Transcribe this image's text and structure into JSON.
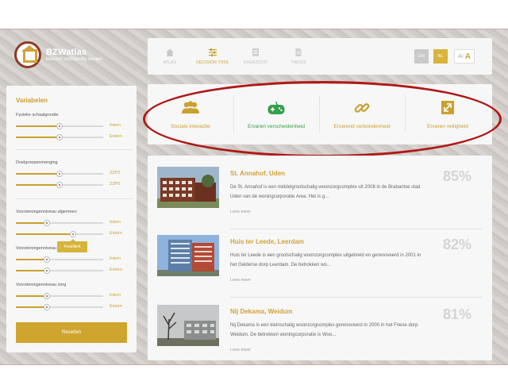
{
  "logo": {
    "title": "BZWatlas",
    "subtitle": "beschut zelfstandig wonen"
  },
  "nav": {
    "items": [
      {
        "label": "ATLAS",
        "icon": "home-icon"
      },
      {
        "label": "DECISION TOOL",
        "icon": "sliders-icon"
      },
      {
        "label": "OVERZICHT",
        "icon": "document-icon"
      },
      {
        "label": "THESIS",
        "icon": "file-icon"
      }
    ],
    "active": "DECISION TOOL"
  },
  "language": {
    "en": "EN",
    "nl": "NL",
    "font_small": "A",
    "font_sep": "/",
    "font_large": "A"
  },
  "sidebar": {
    "title": "Variabelen",
    "groups": [
      {
        "title": "Fysieke schaalgrootte",
        "sliders": [
          {
            "label": "Intern",
            "value": 0.5
          },
          {
            "label": "Extern",
            "value": 0.5
          }
        ]
      },
      {
        "title": "Doelgroepenmenging",
        "sliders": [
          {
            "label": "ZZP2",
            "value": 0.5
          },
          {
            "label": "ZZP5",
            "value": 0.5
          }
        ]
      },
      {
        "title": "Voorzieningenniveau algemeen",
        "sliders": [
          {
            "label": "Intern",
            "value": 0.35
          },
          {
            "label": "Extern",
            "value": 0.65
          }
        ]
      },
      {
        "title": "Voorzieningenniveau",
        "sliders": [
          {
            "label": "Intern",
            "value": 0.35
          },
          {
            "label": "Extern",
            "value": 0.35
          }
        ]
      },
      {
        "title": "Voorzieningenniveau zorg",
        "sliders": [
          {
            "label": "Intern",
            "value": 0.35
          },
          {
            "label": "Extern",
            "value": 0.35
          }
        ]
      }
    ],
    "tooltip": "Kwaliteit",
    "reset_label": "Resetten"
  },
  "filters": [
    {
      "label": "Sociale interactie",
      "icon": "people-icon",
      "color": "#c9a12f"
    },
    {
      "label": "Ervaren verscheidenheid",
      "icon": "gamepad-icon",
      "color": "#35a04a"
    },
    {
      "label": "Ervarend verbondenheid",
      "icon": "link-icon",
      "color": "#c9a12f"
    },
    {
      "label": "Ervaren veiligheid",
      "icon": "expand-icon",
      "color": "#c9a12f"
    }
  ],
  "results": [
    {
      "title": "St. Annahof, Uden",
      "description": "De St. Annahof is een middelgrootschalig woonzorgcomplex uit 2008 in de Brabantse stad Uden van de woningcorporatie Area. Het is g...",
      "more": "Lees meer",
      "score": "85%"
    },
    {
      "title": "Huis ter Leede, Leerdam",
      "description": "Huis ter Leede is een grootschalig woonzorgcomplex uitgebreid en gerenoveerd in 2001 in het Gelderse dorp Leerdam. De betrokken wo...",
      "more": "Lees meer",
      "score": "82%"
    },
    {
      "title": "Nij Dekama, Weidum",
      "description": "Nij Dekama is een kleinschalig woonzorgcomplex gerenoveerd in 2000 in het Friese dorp Weidum. De betrokken woningcorporatie is Woo...",
      "more": "Lees meer",
      "score": "81%"
    }
  ],
  "colors": {
    "accent": "#c9a12f",
    "highlight_oval": "#b01818",
    "green": "#35a04a"
  }
}
